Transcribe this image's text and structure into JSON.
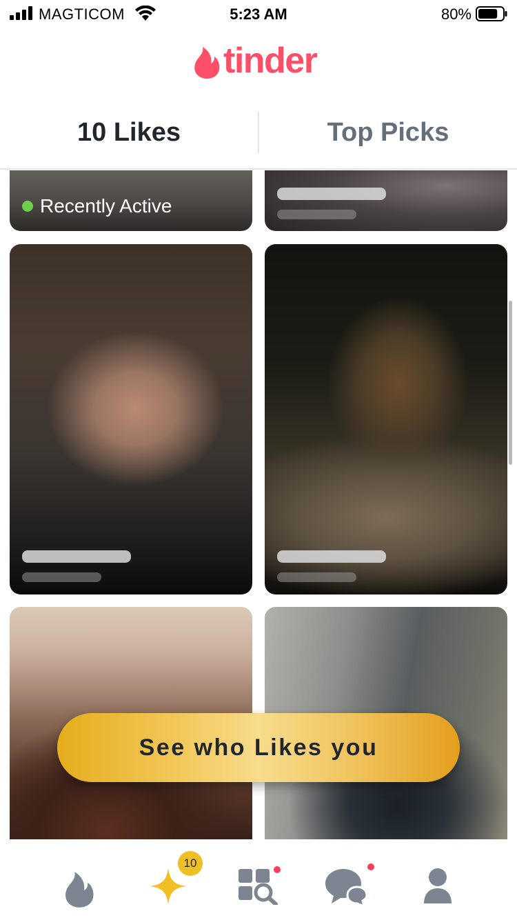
{
  "status_bar": {
    "carrier": "MAGTICOM",
    "time": "5:23 AM",
    "battery_percent": "80%",
    "battery_level": 0.8,
    "icons": [
      "signal-icon",
      "wifi-icon",
      "battery-icon"
    ]
  },
  "header": {
    "logo_text": "tinder",
    "logo_icon": "flame-icon",
    "brand_color": "#fd5068"
  },
  "tabs": [
    {
      "label": "10 Likes",
      "active": true
    },
    {
      "label": "Top Picks",
      "active": false
    }
  ],
  "grid": {
    "recently_active_label": "Recently Active",
    "status_color": "#6cd04a"
  },
  "cta": {
    "label": "See who Likes you",
    "color": "#f0be25"
  },
  "bottom_nav": {
    "items": [
      {
        "icon": "flame-icon",
        "name": "discover"
      },
      {
        "icon": "sparkle-icon",
        "name": "likes",
        "badge": "10"
      },
      {
        "icon": "explore-grid-icon",
        "name": "explore"
      },
      {
        "icon": "chat-bubbles-icon",
        "name": "messages"
      },
      {
        "icon": "profile-icon",
        "name": "profile"
      }
    ],
    "icon_color": "#7c8591",
    "active_color": "#f0be25",
    "notification_color": "#fd3d5a"
  }
}
